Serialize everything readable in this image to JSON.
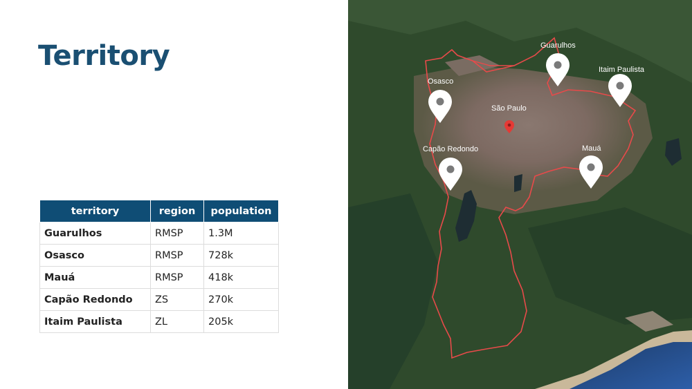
{
  "title": "Territory",
  "table": {
    "headers": [
      "territory",
      "region",
      "population"
    ],
    "rows": [
      {
        "territory": "Guarulhos",
        "region": "RMSP",
        "population": "1.3M"
      },
      {
        "territory": "Osasco",
        "region": "RMSP",
        "population": "728k"
      },
      {
        "territory": "Mauá",
        "region": "RMSP",
        "population": "418k"
      },
      {
        "territory": "Capão Redondo",
        "region": "ZS",
        "population": "270k"
      },
      {
        "territory": "Itaim Paulista",
        "region": "ZL",
        "population": "205k"
      }
    ]
  },
  "map": {
    "labels": {
      "guarulhos": "Guarulhos",
      "itaim": "Itaim Paulista",
      "osasco": "Osasco",
      "sao_paulo": "São Paulo",
      "capao": "Capão Redondo",
      "maua": "Mauá"
    },
    "colors": {
      "boundary": "#e84a4a",
      "pin": "#ffffff",
      "pin_dot": "#7a7a7a",
      "center_pin": "#e53935"
    }
  }
}
